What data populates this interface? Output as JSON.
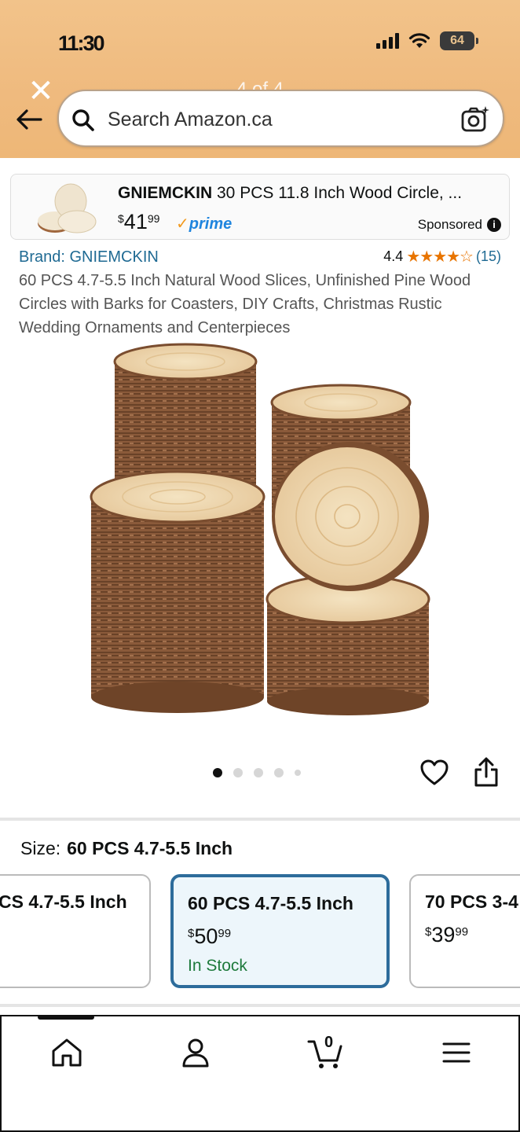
{
  "status_bar": {
    "time": "11:30"
  },
  "header": {
    "close_glyph": "✕",
    "page_indicator": "4 of 4",
    "search_placeholder": "Search Amazon.ca"
  },
  "sponsored": {
    "brand": "GNIEMCKIN",
    "title_rest": " 30 PCS 11.8 Inch Wood Circle, ...",
    "price_symbol": "$",
    "price_whole": "41",
    "price_cents": "99",
    "prime_label": "prime",
    "label": "Sponsored",
    "info_glyph": "i"
  },
  "product": {
    "brand_link": "Brand: GNIEMCKIN",
    "rating_value": "4.4",
    "rating_stars": "★★★★☆",
    "rating_count": "(15)",
    "title": "60 PCS 4.7-5.5 Inch Natural Wood Slices, Unfinished Pine Wood Circles with Barks for Coasters, DIY Crafts, Christmas Rustic Wedding Ornaments and Centerpieces",
    "image_count": 5,
    "active_image": 1
  },
  "size": {
    "label": "Size:",
    "selected": "60 PCS 4.7-5.5 Inch",
    "options": [
      {
        "name": "CS 4.7-5.5 Inch",
        "symbol": "",
        "whole": "",
        "cents": "",
        "stock": ""
      },
      {
        "name": "60 PCS 4.7-5.5 Inch",
        "symbol": "$",
        "whole": "50",
        "cents": "99",
        "stock": "In Stock"
      },
      {
        "name": "70 PCS 3-4",
        "symbol": "$",
        "whole": "39",
        "cents": "99",
        "stock": ""
      }
    ]
  },
  "bottom_nav": {
    "cart_count": "0"
  },
  "colors": {
    "header_bg": "#efba7e",
    "link": "#1f6a93",
    "star": "#e87400",
    "in_stock": "#1e7a3c",
    "selected_border": "#2d6c9b"
  }
}
